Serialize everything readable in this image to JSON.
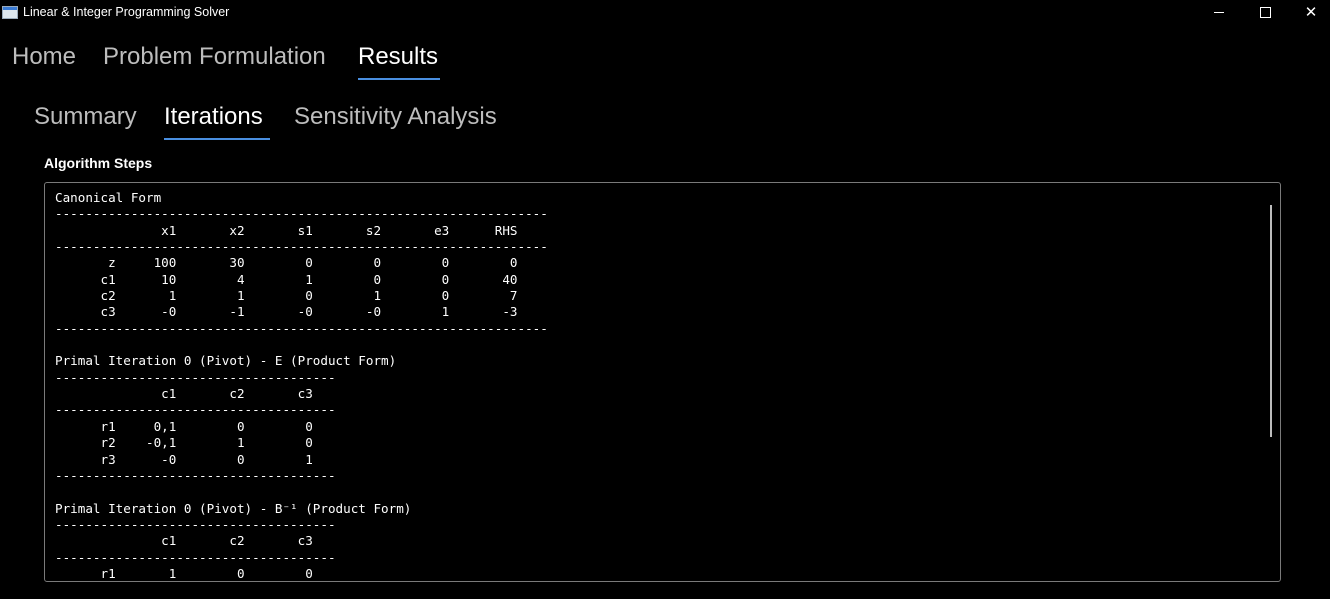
{
  "window": {
    "title": "Linear & Integer Programming Solver"
  },
  "nav": {
    "tabs": [
      "Home",
      "Problem Formulation",
      "Results"
    ],
    "active": "Results"
  },
  "subnav": {
    "tabs": [
      "Summary",
      "Iterations",
      "Sensitivity Analysis"
    ],
    "active": "Iterations"
  },
  "section": {
    "title": "Algorithm Steps"
  },
  "steps": {
    "text": "Canonical Form\n-----------------------------------------------------------------\n              x1       x2       s1       s2       e3      RHS\n-----------------------------------------------------------------\n       z     100       30        0        0        0        0\n      c1      10        4        1        0        0       40\n      c2       1        1        0        1        0        7\n      c3      -0       -1       -0       -0        1       -3\n-----------------------------------------------------------------\n\nPrimal Iteration 0 (Pivot) - E (Product Form)\n-------------------------------------\n              c1       c2       c3\n-------------------------------------\n      r1     0,1        0        0\n      r2    -0,1        1        0\n      r3      -0        0        1\n-------------------------------------\n\nPrimal Iteration 0 (Pivot) - B⁻¹ (Product Form)\n-------------------------------------\n              c1       c2       c3\n-------------------------------------\n      r1       1        0        0"
  }
}
